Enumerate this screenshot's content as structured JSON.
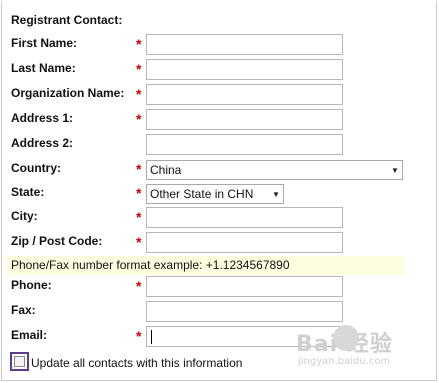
{
  "form": {
    "section_title": "Registrant Contact:",
    "fields": [
      {
        "label": "First Name:",
        "required": true,
        "value": ""
      },
      {
        "label": "Last Name:",
        "required": true,
        "value": ""
      },
      {
        "label": "Organization Name:",
        "required": true,
        "value": ""
      },
      {
        "label": "Address 1:",
        "required": true,
        "value": ""
      },
      {
        "label": "Address 2:",
        "required": false,
        "value": ""
      },
      {
        "label": "Country:",
        "required": true,
        "value": "China"
      },
      {
        "label": "State:",
        "required": true,
        "value": "Other State in CHN"
      },
      {
        "label": "City:",
        "required": true,
        "value": ""
      },
      {
        "label": "Zip / Post Code:",
        "required": true,
        "value": ""
      },
      {
        "label": "Phone:",
        "required": true,
        "value": ""
      },
      {
        "label": "Fax:",
        "required": false,
        "value": ""
      },
      {
        "label": "Email:",
        "required": true,
        "value": ""
      }
    ],
    "required_marker": "*",
    "phone_hint": "Phone/Fax number format example: +1.1234567890",
    "update_all": {
      "label": "Update all contacts with this information",
      "checked": false
    }
  },
  "watermark": {
    "brand": "Bai  经验",
    "sub": "jingyan.baidu.com"
  },
  "colors": {
    "required": "#d00000",
    "hint_bg": "#fffde0",
    "checkbox_focus": "#5a3e8c"
  }
}
